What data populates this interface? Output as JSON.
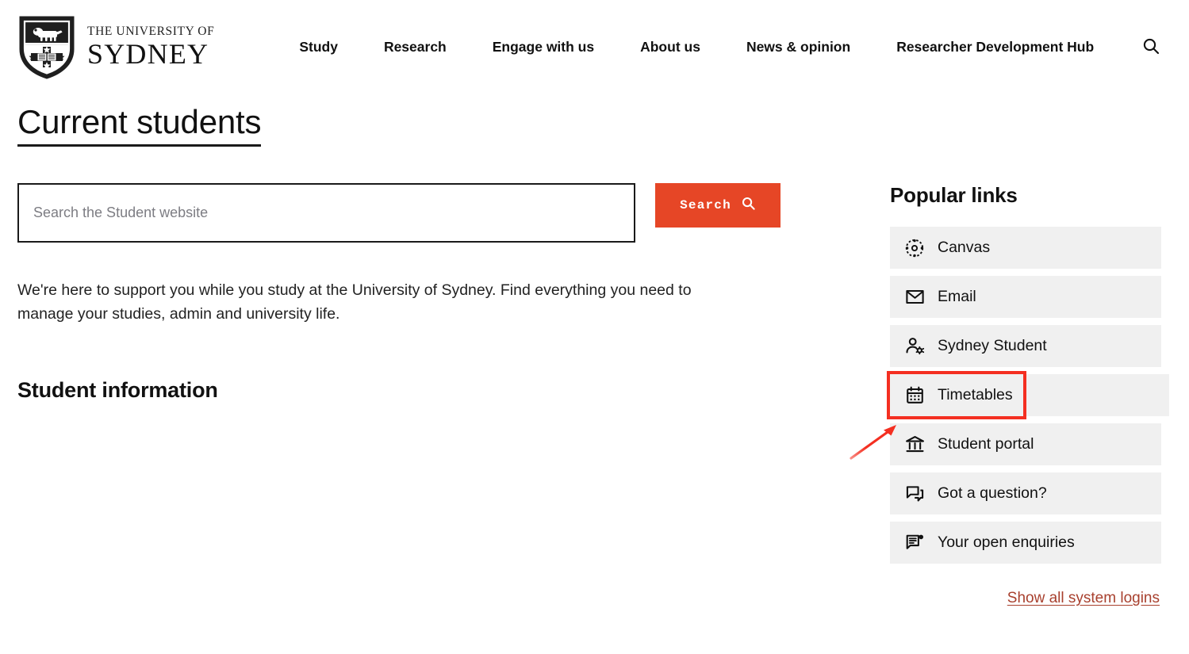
{
  "header": {
    "logo": {
      "crest_icon": "usyd-shield-crest-icon",
      "line1": "THE UNIVERSITY OF",
      "line2": "SYDNEY"
    },
    "nav": [
      {
        "label": "Study",
        "name": "nav-item-study"
      },
      {
        "label": "Research",
        "name": "nav-item-research"
      },
      {
        "label": "Engage with us",
        "name": "nav-item-engage-with-us"
      },
      {
        "label": "About us",
        "name": "nav-item-about-us"
      },
      {
        "label": "News & opinion",
        "name": "nav-item-news-opinion"
      },
      {
        "label": "Researcher Development Hub",
        "name": "nav-item-researcher-development-hub"
      }
    ],
    "search_icon": "search-icon"
  },
  "page": {
    "title": "Current students",
    "intro": "We're here to support you while you study at the University of Sydney. Find everything you need to manage your studies, admin and university life.",
    "section_heading": "Student information"
  },
  "search": {
    "value": "",
    "placeholder": "Search the Student website",
    "button_label": "Search",
    "button_icon": "search-icon",
    "button_color": "#E64626"
  },
  "popular_links": {
    "title": "Popular links",
    "items": [
      {
        "label": "Canvas",
        "icon": "canvas-logo-icon",
        "highlighted": false
      },
      {
        "label": "Email",
        "icon": "envelope-icon",
        "highlighted": false
      },
      {
        "label": "Sydney Student",
        "icon": "person-gear-icon",
        "highlighted": false
      },
      {
        "label": "Timetables",
        "icon": "calendar-icon",
        "highlighted": true
      },
      {
        "label": "Student portal",
        "icon": "bank-columns-icon",
        "highlighted": false
      },
      {
        "label": "Got a question?",
        "icon": "chat-bubbles-icon",
        "highlighted": false
      },
      {
        "label": "Your open enquiries",
        "icon": "document-chat-badge-icon",
        "highlighted": false
      }
    ],
    "show_all_label": "Show all system logins",
    "show_all_color": "#A8402E"
  },
  "annotation": {
    "highlight_color": "#F42F21",
    "arrow_icon": "red-arrow-pointing-up-right-icon",
    "target": "Timetables"
  }
}
